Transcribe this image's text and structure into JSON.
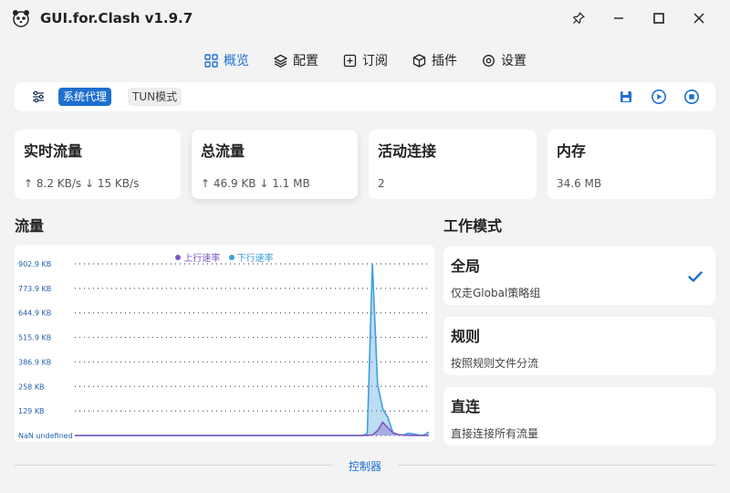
{
  "app": {
    "title": "GUI.for.Clash v1.9.7"
  },
  "nav": {
    "items": [
      {
        "label": "概览",
        "icon": "grid-icon",
        "active": true
      },
      {
        "label": "配置",
        "icon": "layers-icon",
        "active": false
      },
      {
        "label": "订阅",
        "icon": "plus-square-icon",
        "active": false
      },
      {
        "label": "插件",
        "icon": "cube-icon",
        "active": false
      },
      {
        "label": "设置",
        "icon": "gear-icon",
        "active": false
      }
    ]
  },
  "toolbar": {
    "system_proxy_label": "系统代理",
    "tun_label": "TUN模式",
    "system_proxy_on": true,
    "tun_on": false
  },
  "stats": [
    {
      "title": "实时流量",
      "value": "↑ 8.2 KB/s ↓ 15 KB/s"
    },
    {
      "title": "总流量",
      "value": "↑ 46.9 KB ↓ 1.1 MB"
    },
    {
      "title": "活动连接",
      "value": "2"
    },
    {
      "title": "内存",
      "value": "34.6 MB"
    }
  ],
  "traffic": {
    "title": "流量"
  },
  "chart_data": {
    "type": "area",
    "series": [
      {
        "name": "上行速率",
        "color": "#7e57c2",
        "values": [
          0,
          0,
          0,
          0,
          0,
          0,
          0,
          0,
          0,
          0,
          0,
          0,
          0,
          0,
          0,
          0,
          0,
          0,
          0,
          0,
          0,
          0,
          0,
          0,
          0,
          0,
          0,
          0,
          0,
          0,
          0,
          0,
          0,
          0,
          0,
          0,
          0,
          0,
          0,
          0,
          0,
          0,
          0,
          0,
          0,
          0,
          0,
          0,
          0,
          0,
          0,
          0,
          0,
          0,
          0,
          0,
          0,
          1,
          3,
          25,
          70,
          40,
          15,
          5,
          2,
          1,
          0,
          0,
          0,
          0
        ]
      },
      {
        "name": "下行速率",
        "color": "#3f9fdc",
        "values": [
          0,
          0,
          0,
          0,
          0,
          0,
          0,
          0,
          0,
          0,
          0,
          0,
          0,
          0,
          0,
          0,
          0,
          0,
          0,
          0,
          0,
          0,
          0,
          0,
          0,
          0,
          0,
          0,
          0,
          0,
          0,
          0,
          0,
          0,
          0,
          0,
          0,
          0,
          0,
          0,
          0,
          0,
          0,
          0,
          0,
          0,
          0,
          0,
          0,
          0,
          0,
          0,
          0,
          0,
          0,
          0,
          0,
          10,
          902.9,
          270,
          140,
          95,
          15,
          5,
          3,
          12,
          8,
          3,
          2,
          18
        ]
      }
    ],
    "ytick_labels": [
      "NaN undefined",
      "129 KB",
      "258 KB",
      "386.9 KB",
      "515.9 KB",
      "644.9 KB",
      "773.9 KB",
      "902.9 KB"
    ],
    "ytick_values": [
      0,
      129,
      258,
      386.9,
      515.9,
      644.9,
      773.9,
      902.9
    ],
    "ylim": [
      0,
      902.9
    ],
    "grid": true,
    "legend": "top-center"
  },
  "mode": {
    "title": "工作模式",
    "items": [
      {
        "name": "全局",
        "desc": "仅走Global策略组",
        "selected": true
      },
      {
        "name": "规则",
        "desc": "按照规则文件分流",
        "selected": false
      },
      {
        "name": "直连",
        "desc": "直接连接所有流量",
        "selected": false
      }
    ]
  },
  "footer": {
    "label": "控制器"
  },
  "colors": {
    "accent": "#1e6fd0",
    "upload": "#7e57c2",
    "download": "#3f9fdc"
  }
}
